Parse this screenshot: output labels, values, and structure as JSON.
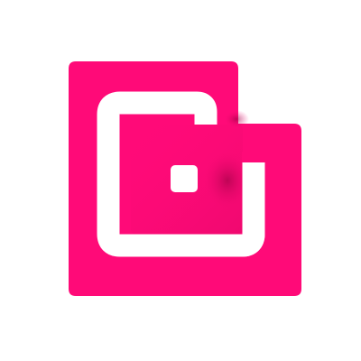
{
  "logo": {
    "icon": "nested-square-spiral-logo",
    "colors": {
      "brand": "#FF0A78",
      "brand_shadow": "#B8004F",
      "background": "#FFFFFF",
      "cutout": "#FFFFFF"
    }
  }
}
